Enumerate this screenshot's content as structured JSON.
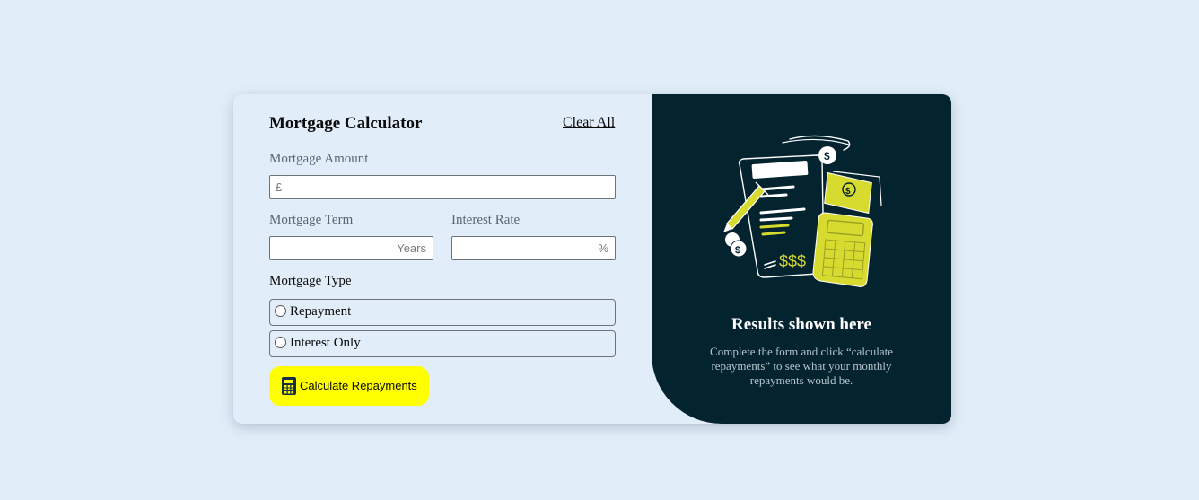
{
  "form": {
    "title": "Mortgage Calculator",
    "clear_label": "Clear All",
    "amount": {
      "label": "Mortgage Amount",
      "prefix": "£",
      "value": ""
    },
    "term": {
      "label": "Mortgage Term",
      "suffix": "Years",
      "value": ""
    },
    "rate": {
      "label": "Interest Rate",
      "suffix": "%",
      "value": ""
    },
    "type": {
      "label": "Mortgage Type",
      "options": [
        "Repayment",
        "Interest Only"
      ]
    },
    "submit_label": "Calculate Repayments"
  },
  "results": {
    "title": "Results shown here",
    "description": "Complete the form and click “calculate repayments” to see what your monthly repayments would be."
  },
  "colors": {
    "page_bg": "#e1eef9",
    "panel_dark": "#03232f",
    "accent_yellow": "#ffff00",
    "lime": "#d7da2f"
  },
  "icons": {
    "button": "calculator-icon",
    "illustration": "empty-results-illustration"
  }
}
